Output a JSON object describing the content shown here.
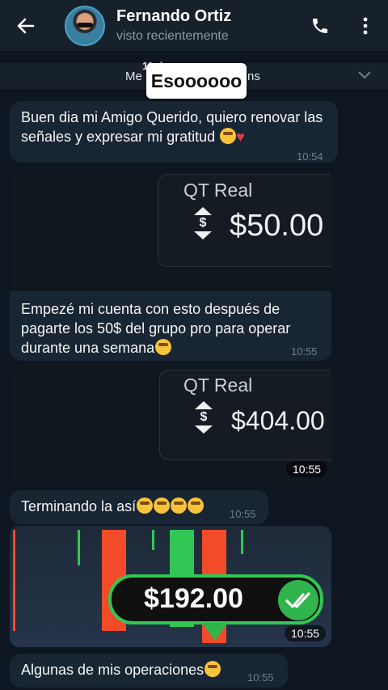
{
  "header": {
    "contact_name": "Fernando Ortiz",
    "status": "visto recientemente",
    "back_icon": "arrow-left-icon",
    "call_icon": "phone-icon",
    "menu_icon": "kebab-menu-icon"
  },
  "pinned": {
    "date": "11 de",
    "text_left": "Me",
    "text_right": "ns",
    "sticker_label": "Esoooooo"
  },
  "messages": [
    {
      "text": "Buen dia mi Amigo Querido, quiero renovar las señales y expresar mi gratitud",
      "time": "10:54"
    },
    {
      "text": "Empezé mi cuenta con esto después de pagarte los 50$ del grupo pro para operar durante una semana",
      "time": "10:55"
    },
    {
      "text": "Terminando la así",
      "time": "10:55"
    },
    {
      "text": "Algunas de mis operaciones",
      "time": "10:55"
    }
  ],
  "media": [
    {
      "card_title": "QT Real",
      "amount": "$50.00"
    },
    {
      "card_title": "QT Real",
      "amount": "$404.00",
      "time": "10:55"
    },
    {
      "profit": "$192.00",
      "time": "10:55"
    }
  ],
  "colors": {
    "bg": "#0e1621",
    "bubble": "#182533",
    "header": "#17212b",
    "green": "#32c754",
    "red": "#f24b2a"
  }
}
